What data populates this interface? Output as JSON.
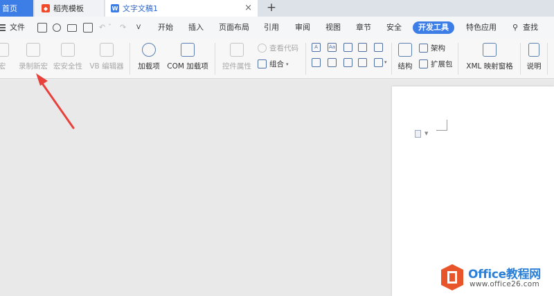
{
  "tabs": {
    "home": "首页",
    "daoke": "稻壳模板",
    "doc": "文字文稿1",
    "close": "×",
    "new": "+"
  },
  "menu": {
    "file": "文件",
    "more": "»",
    "items": [
      "开始",
      "插入",
      "页面布局",
      "引用",
      "审阅",
      "视图",
      "章节",
      "安全"
    ],
    "active": "开发工具",
    "special": "特色应用",
    "search": "查找"
  },
  "ribbon": {
    "macro": "宏",
    "record_macro": "录制新宏",
    "macro_security": "宏安全性",
    "vb_editor": "VB 编辑器",
    "addins": "加载项",
    "com_addins": "COM 加载项",
    "control_props": "控件属性",
    "view_code": "查看代码",
    "group": "组合",
    "structure": "结构",
    "schema": "架构",
    "expansion": "扩展包",
    "xml_mapping": "XML 映射窗格",
    "help": "说明",
    "mini_control_labels": [
      "A",
      "Aa",
      "",
      "",
      "",
      "",
      "",
      "",
      "",
      ""
    ]
  },
  "colors": {
    "accent": "#3c7ee6",
    "arrow": "#e8413b",
    "brand_orange": "#e8552a",
    "brand_blue": "#2a7fd8"
  },
  "watermark": {
    "title": "Office教程网",
    "url": "www.office26.com"
  }
}
